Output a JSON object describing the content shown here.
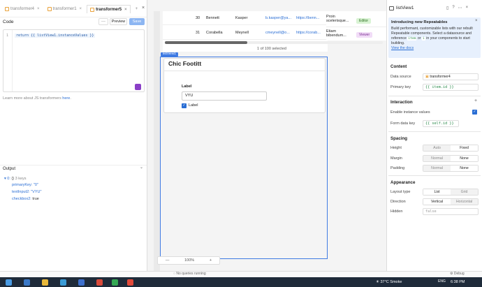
{
  "tabs": [
    {
      "label": "transformer4",
      "active": false
    },
    {
      "label": "transformer1",
      "active": false
    },
    {
      "label": "transformer5",
      "active": true
    }
  ],
  "code_panel": {
    "title": "Code",
    "preview_label": "Preview",
    "save_label": "Save",
    "more_label": "···",
    "line_number": "1",
    "code_text": "return {{ listView1.instanceValues }}",
    "learn_text": "Learn more about JS transformers",
    "learn_link": "here",
    "learn_suffix": "."
  },
  "output": {
    "title": "Output",
    "root_label": "0:",
    "root_type": "{}",
    "root_count": "3 keys",
    "rows": [
      {
        "key": "primaryKey:",
        "value": "\"0\""
      },
      {
        "key": "textInput2:",
        "value": "\"VYU\""
      },
      {
        "key": "checkbox2:",
        "value": "true"
      }
    ]
  },
  "table": {
    "rows": [
      {
        "id": "30",
        "first": "Bennett",
        "last": "Kasper",
        "email": "b.kasper@ya...",
        "url": "https://benn...",
        "desc1": "Proin",
        "desc2": "scelerisque...",
        "role": "Editor"
      },
      {
        "id": "31",
        "first": "Corabella",
        "last": "Meynell",
        "email": "cmeynell@o...",
        "url": "https://corab...",
        "desc1": "Etiam",
        "desc2": "bibendum...",
        "role": "Viewer"
      }
    ],
    "selection_text": "1 of 100 selected"
  },
  "listview": {
    "tag": "listView1",
    "card_title": "Chic Footitt",
    "input_label": "Label",
    "input_value": "VYU",
    "checkbox_label": "Label"
  },
  "zoom": {
    "minus": "—",
    "value": "100%",
    "plus": "+"
  },
  "inspector": {
    "component_name": "listView1",
    "info_title": "Introducing new Repeatables",
    "info_text_1": "Build performant, customizable lists with our rebuilt Repeatable components. Select a datasource and reference",
    "info_code_item": "item",
    "info_or": "or",
    "info_code_i": "i",
    "info_text_2": "in your components to start building.",
    "info_link": "View the docs",
    "content": {
      "title": "Content",
      "datasource_label": "Data source",
      "datasource_value": "transformer4",
      "primarykey_label": "Primary key",
      "primarykey_value": "{{ item.id }}"
    },
    "interaction": {
      "title": "Interaction",
      "enable_label": "Enable instance values",
      "formkey_label": "Form data key",
      "formkey_value": "{{ self.id }}"
    },
    "spacing": {
      "title": "Spacing",
      "height_label": "Height",
      "height_opts": [
        "Auto",
        "Fixed"
      ],
      "margin_label": "Margin",
      "margin_opts": [
        "Normal",
        "None"
      ],
      "padding_label": "Padding",
      "padding_opts": [
        "Normal",
        "None"
      ]
    },
    "appearance": {
      "title": "Appearance",
      "layout_label": "Layout type",
      "layout_opts": [
        "List",
        "Grid"
      ],
      "direction_label": "Direction",
      "direction_opts": [
        "Vertical",
        "Horizontal"
      ],
      "hidden_label": "Hidden",
      "hidden_value": "false"
    }
  },
  "status": {
    "queries": "No queries running",
    "debug": "Debug"
  },
  "taskbar": {
    "weather": "37°C Smoke",
    "lang": "ENG",
    "clock": "6:38 PM"
  },
  "colors": {
    "accent": "#3f7be3",
    "save": "#8db6f2",
    "editor_badge": "#d9f3d4",
    "viewer_badge": "#f1dcf7"
  }
}
